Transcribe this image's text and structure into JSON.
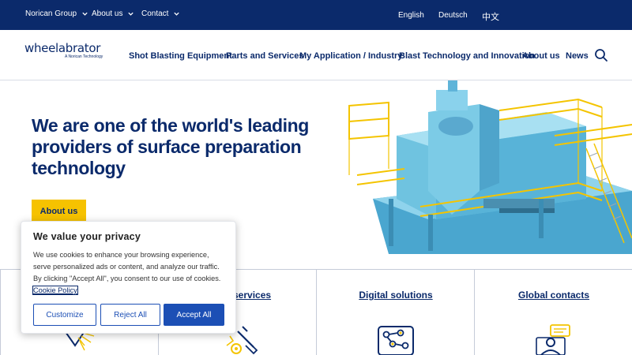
{
  "topbar": {
    "links": [
      {
        "label": "Norican Group"
      },
      {
        "label": "About us"
      },
      {
        "label": "Contact"
      }
    ],
    "languages": [
      "English",
      "Deutsch",
      "中文"
    ]
  },
  "logo": {
    "word": "wheelabrator",
    "tagline": "A Norican Technology"
  },
  "nav": {
    "items": [
      {
        "label": "Shot Blasting Equipment"
      },
      {
        "label": "Parts and Services"
      },
      {
        "label": "My Application / Industry"
      },
      {
        "label": "Blast Technology and Innovation"
      },
      {
        "label": "About us"
      },
      {
        "label": "News"
      }
    ],
    "search_icon": "search-icon"
  },
  "hero": {
    "title": "We are one of the world's leading providers of surface preparation technology",
    "button_label": "About us"
  },
  "cards": [
    {
      "title": "",
      "icon": "blast-icon"
    },
    {
      "title": "et services",
      "icon": "tools-icon"
    },
    {
      "title": "Digital solutions",
      "icon": "network-icon"
    },
    {
      "title": "Global contacts",
      "icon": "contact-icon"
    }
  ],
  "cookie": {
    "title": "We value your privacy",
    "text": "We use cookies to enhance your browsing experience, serve personalized ads or content, and analyze our traffic. By clicking \"Accept All\", you consent to our use of cookies.",
    "policy_link": "Cookie Policy",
    "buttons": {
      "customize": "Customize",
      "reject": "Reject All",
      "accept": "Accept All"
    }
  },
  "colors": {
    "navy": "#0b2a6b",
    "yellow": "#f6c200",
    "blue_button": "#1c4fb5",
    "machine_blue": "#6fc3e0"
  }
}
